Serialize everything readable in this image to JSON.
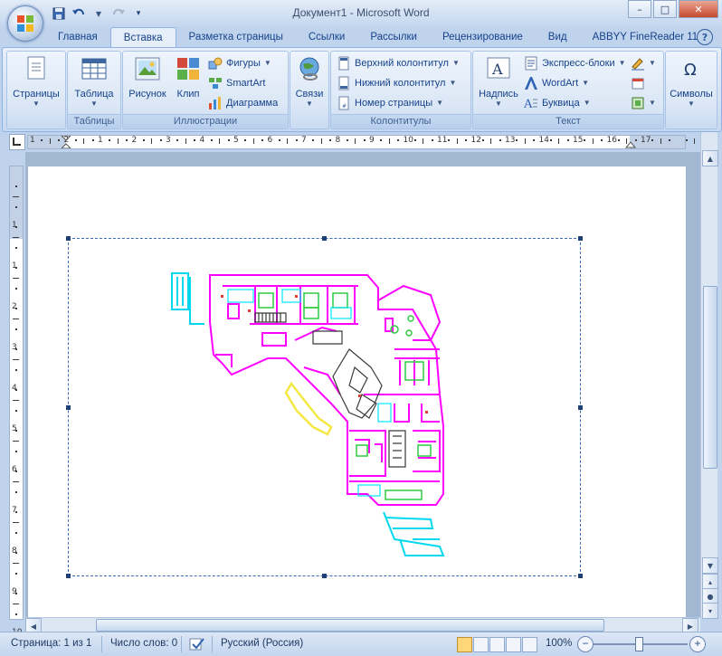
{
  "window": {
    "title": "Документ1 - Microsoft Word",
    "controls": {
      "minimize": "–",
      "maximize": "□",
      "close": "✕"
    }
  },
  "quick_access": {
    "save_icon": "save-icon",
    "undo_icon": "undo-icon",
    "redo_icon": "redo-icon",
    "customize_icon": "customize-icon"
  },
  "tabs": [
    {
      "label": "Главная",
      "active": false
    },
    {
      "label": "Вставка",
      "active": true
    },
    {
      "label": "Разметка страницы",
      "active": false
    },
    {
      "label": "Ссылки",
      "active": false
    },
    {
      "label": "Рассылки",
      "active": false
    },
    {
      "label": "Рецензирование",
      "active": false
    },
    {
      "label": "Вид",
      "active": false
    },
    {
      "label": "ABBYY FineReader 11",
      "active": false
    }
  ],
  "help": "?",
  "ribbon": {
    "pages": {
      "button": "Страницы"
    },
    "tables": {
      "button": "Таблица",
      "group": "Таблицы"
    },
    "illustrations": {
      "group": "Иллюстрации",
      "picture": "Рисунок",
      "clip": "Клип",
      "shapes": "Фигуры",
      "smartart": "SmartArt",
      "chart": "Диаграмма"
    },
    "links": {
      "button": "Связи"
    },
    "header_footer": {
      "group": "Колонтитулы",
      "header": "Верхний колонтитул",
      "footer": "Нижний колонтитул",
      "page_number": "Номер страницы"
    },
    "text": {
      "group": "Текст",
      "textbox": "Надпись",
      "quick_parts": "Экспресс-блоки",
      "wordart": "WordArt",
      "dropcap": "Буквица"
    },
    "symbols": {
      "button": "Символы"
    }
  },
  "ruler": {
    "h_numbers": [
      "1",
      "2",
      "1",
      "2",
      "3",
      "4",
      "5",
      "6",
      "7",
      "8",
      "9",
      "10",
      "11",
      "12",
      "13",
      "14",
      "15",
      "16",
      "17"
    ],
    "v_numbers": [
      "1",
      "1",
      "2",
      "3",
      "4",
      "5",
      "6",
      "7",
      "8",
      "9",
      "10"
    ]
  },
  "status": {
    "page": "Страница: 1 из 1",
    "words": "Число слов: 0",
    "language": "Русский (Россия)",
    "zoom": "100%",
    "zoom_minus": "−",
    "zoom_plus": "+"
  },
  "colors": {
    "accent": "#15428b",
    "plan_walls": "#ff00ff",
    "plan_cyan": "#00e5ff",
    "plan_green": "#2ecc40",
    "plan_yellow": "#f4e842"
  }
}
